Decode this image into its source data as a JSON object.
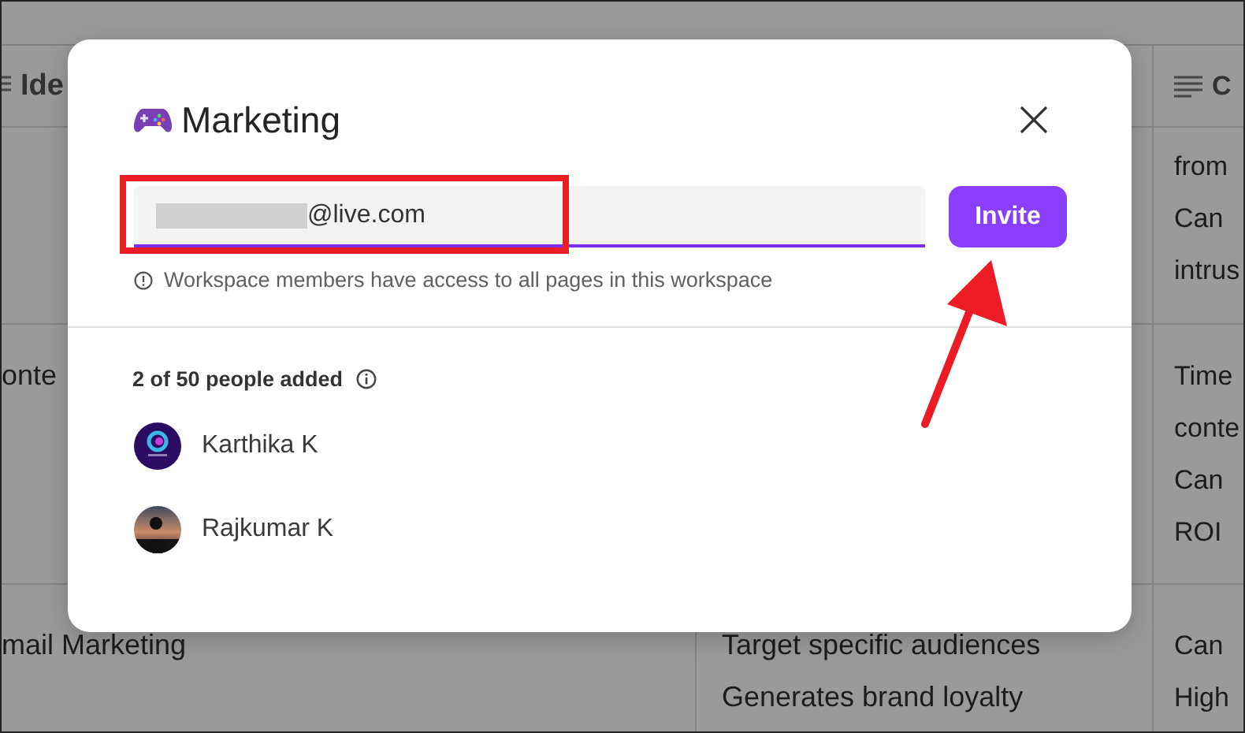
{
  "background_table": {
    "header": {
      "column_1": "Ide",
      "column_3": "C"
    },
    "rows": [
      {
        "column_1": [],
        "column_2": [],
        "column_3": [
          "from",
          "Can",
          "intrus"
        ]
      },
      {
        "column_1": [
          "onte"
        ],
        "column_2": [],
        "column_3": [
          "Time",
          "conte",
          "Can",
          "ROI"
        ]
      },
      {
        "column_1": [
          "mail Marketing"
        ],
        "column_2": [
          "Target specific audiences",
          "Generates brand loyalty"
        ],
        "column_3": [
          "Can",
          "High"
        ]
      }
    ]
  },
  "dialog": {
    "title": "Marketing",
    "email_field": {
      "value": "@live.com",
      "redacted": true,
      "focused": true
    },
    "invite_button": "Invite",
    "hint": "Workspace members have access to all pages in this workspace",
    "people_count": "2 of 50 people added",
    "members": [
      {
        "name": "Karthika K",
        "kind": "logo"
      },
      {
        "name": "Rajkumar K",
        "kind": "photo"
      }
    ]
  },
  "annotations": {
    "highlight_box": true,
    "arrow": true
  }
}
